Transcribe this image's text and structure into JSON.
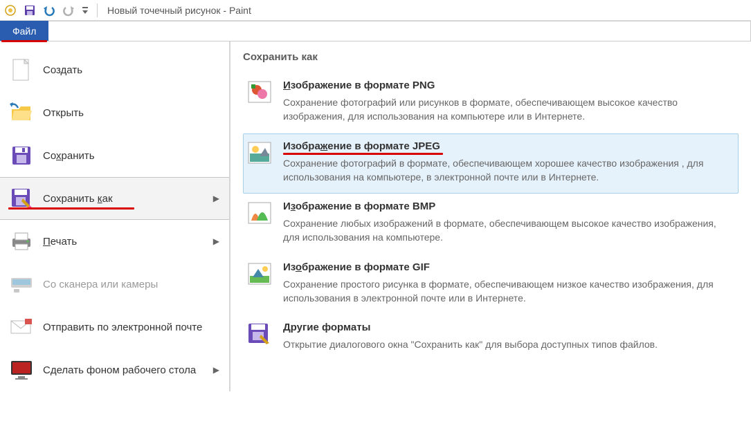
{
  "titlebar": {
    "title": "Новый точечный рисунок - Paint"
  },
  "tabs": {
    "file": "Файл"
  },
  "left_menu": {
    "create": "Создать",
    "open": "Открыть",
    "save": "Сохранить",
    "save_as": "Сохранить как",
    "print": "Печать",
    "scanner": "Со сканера или камеры",
    "email": "Отправить по электронной почте",
    "wallpaper": "Сделать фоном рабочего стола"
  },
  "right_panel": {
    "title": "Сохранить как",
    "png_title": "Изображение в формате PNG",
    "png_desc": "Сохранение фотографий или рисунков в формате, обеспечивающем высокое качество изображения, для использования на компьютере или в Интернете.",
    "jpeg_title": "Изображение в формате JPEG",
    "jpeg_desc": "Сохранение фотографий в формате, обеспечивающем хорошее качество изображения , для использования на компьютере, в электронной почте или в Интернете.",
    "bmp_title": "Изображение в формате BMP",
    "bmp_desc": "Сохранение любых изображений в формате, обеспечивающем высокое качество изображения, для использования на компьютере.",
    "gif_title": "Изображение в формате GIF",
    "gif_desc": "Сохранение простого рисунка в формате, обеспечивающем низкое качество изображения, для использования в электронной почте или в Интернете.",
    "other_title": "Другие форматы",
    "other_desc": "Открытие диалогового окна \"Сохранить как\" для выбора доступных типов файлов."
  }
}
